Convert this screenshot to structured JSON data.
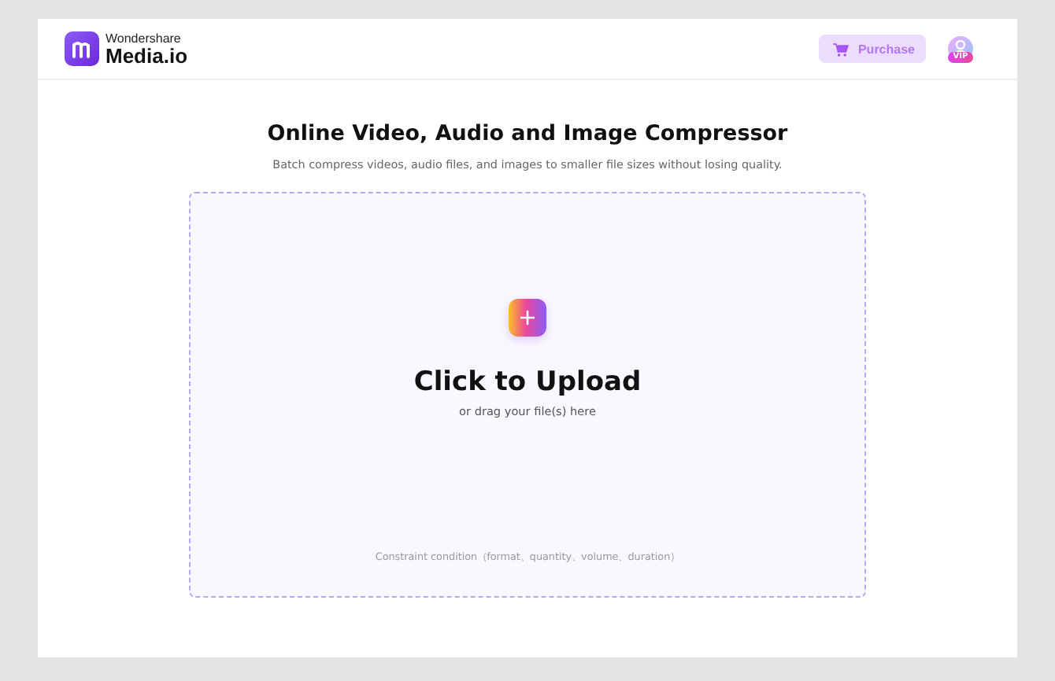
{
  "header": {
    "brand_top": "Wondershare",
    "brand_name": "Media.io",
    "purchase_button": "Purchase",
    "vip_badge": "VIP"
  },
  "title": "Online Video, Audio and Image Compressor",
  "subtitle": "Batch compress videos, audio files, and images to smaller file sizes without losing quality.",
  "upload": {
    "heading": "Click to Upload",
    "hint": "or drag your file(s) here",
    "constraint": "Constraint condition（format、quantity、volume、duration）"
  }
}
